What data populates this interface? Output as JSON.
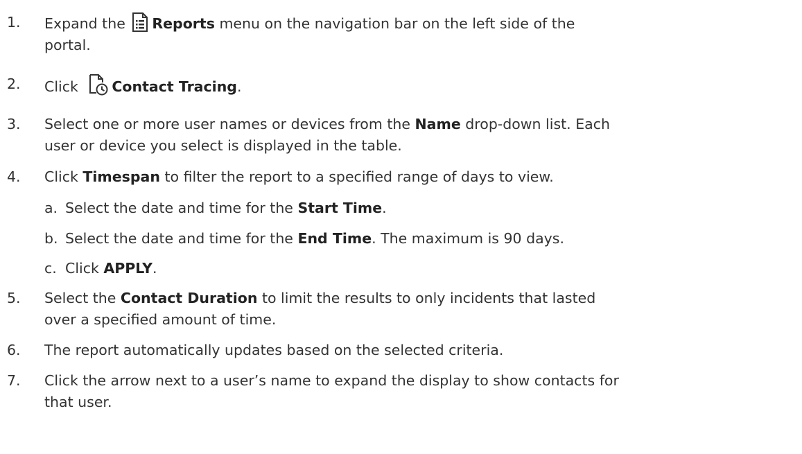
{
  "steps": [
    {
      "num": "1.",
      "pre": "Expand the",
      "icon": "reports-icon",
      "bold": "Reports",
      "post": " menu on the navigation bar on the left side of the",
      "line2": "portal."
    },
    {
      "num": "2.",
      "pre": "Click",
      "icon": "contact-tracing-icon",
      "bold": "Contact Tracing",
      "post": "."
    },
    {
      "num": "3.",
      "pre": "Select one or more user names or devices from the ",
      "bold": "Name",
      "post": " drop-down list. Each",
      "line2": "user or device you select is displayed in the table."
    },
    {
      "num": "4.",
      "pre": "Click ",
      "bold": "Timespan",
      "post": " to filter the report to a specified range of days to view.",
      "sub": [
        {
          "num": "a.",
          "pre": "Select the date and time for the ",
          "bold": "Start Time",
          "post": "."
        },
        {
          "num": "b.",
          "pre": "Select the date and time for the ",
          "bold": "End Time",
          "post": ". The maximum is 90 days."
        },
        {
          "num": "c.",
          "pre": "Click ",
          "bold": "APPLY",
          "post": "."
        }
      ]
    },
    {
      "num": "5.",
      "pre": "Select the ",
      "bold": "Contact Duration",
      "post": " to limit the results to only incidents that lasted",
      "line2": "over a specified amount of time."
    },
    {
      "num": "6.",
      "text": "The report automatically updates based on the selected criteria."
    },
    {
      "num": "7.",
      "text": "Click the arrow next to a user’s name to expand the display to show contacts for",
      "line2": "that user."
    }
  ]
}
